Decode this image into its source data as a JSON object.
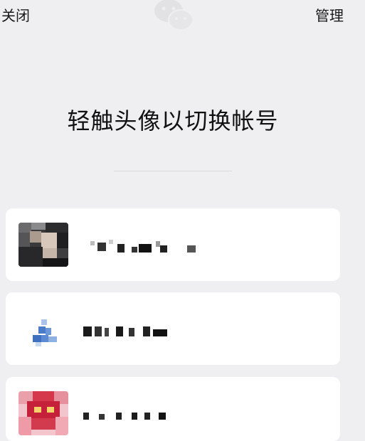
{
  "header": {
    "close_label": "关闭",
    "manage_label": "管理",
    "logo_icon": "wechat-logo-icon"
  },
  "main": {
    "title": "轻触头像以切换帐号"
  },
  "accounts": [
    {
      "avatar_icon": "avatar-photo-pixelated"
    },
    {
      "avatar_icon": "avatar-default-blue-pixelated"
    },
    {
      "avatar_icon": "avatar-red-pixelated"
    }
  ],
  "colors": {
    "background": "#efeff1",
    "card": "#ffffff",
    "text": "#111111"
  }
}
